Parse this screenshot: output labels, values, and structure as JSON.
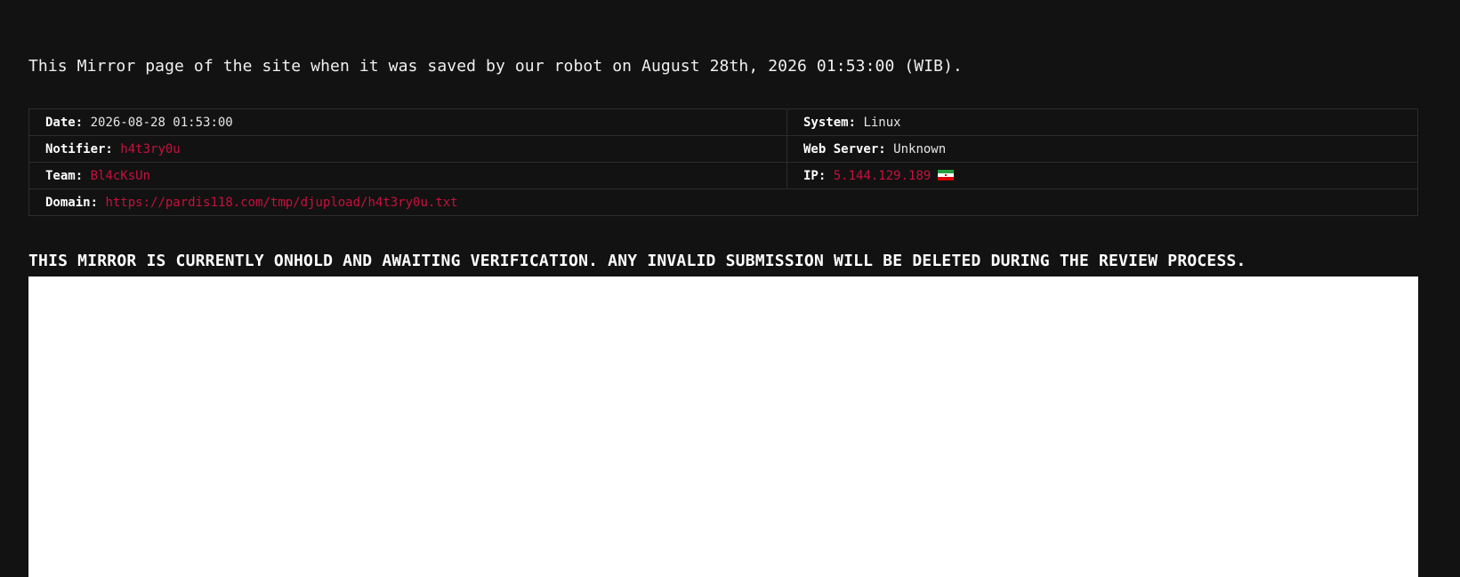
{
  "intro_text": "This Mirror page of the site when it was saved by our robot on August 28th, 2026 01:53:00 (WIB).",
  "info": {
    "date": {
      "label": "Date:",
      "value": "2026-08-28 01:53:00"
    },
    "system": {
      "label": "System:",
      "value": "Linux"
    },
    "notifier": {
      "label": "Notifier:",
      "value": "h4t3ry0u"
    },
    "web_server": {
      "label": "Web Server:",
      "value": "Unknown"
    },
    "team": {
      "label": "Team:",
      "value": "Bl4cKsUn"
    },
    "ip": {
      "label": "IP:",
      "value": "5.144.129.189",
      "flag_icon": "iran-flag-icon"
    },
    "domain": {
      "label": "Domain:",
      "value": "https://pardis118.com/tmp/djupload/h4t3ry0u.txt"
    }
  },
  "notice_text": "THIS MIRROR IS CURRENTLY ONHOLD AND AWAITING VERIFICATION. ANY INVALID SUBMISSION WILL BE DELETED DURING THE REVIEW PROCESS.",
  "colors": {
    "background": "#121212",
    "accent_red": "#c8103c",
    "frame": "#ffffff"
  }
}
